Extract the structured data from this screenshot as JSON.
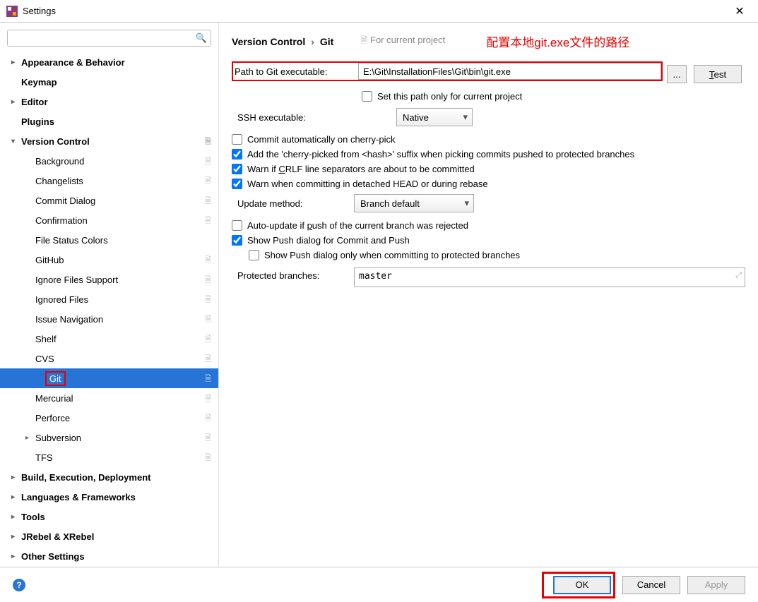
{
  "window": {
    "title": "Settings"
  },
  "search": {
    "placeholder": ""
  },
  "sidebar": {
    "items": [
      {
        "label": "Appearance & Behavior",
        "level": 1,
        "expandable": true,
        "expanded": false
      },
      {
        "label": "Keymap",
        "level": 1,
        "expandable": false
      },
      {
        "label": "Editor",
        "level": 1,
        "expandable": true,
        "expanded": false
      },
      {
        "label": "Plugins",
        "level": 1,
        "expandable": false
      },
      {
        "label": "Version Control",
        "level": 1,
        "expandable": true,
        "expanded": true,
        "copy": true
      },
      {
        "label": "Background",
        "level": 2,
        "copy": true
      },
      {
        "label": "Changelists",
        "level": 2,
        "copy": true
      },
      {
        "label": "Commit Dialog",
        "level": 2,
        "copy": true
      },
      {
        "label": "Confirmation",
        "level": 2,
        "copy": true
      },
      {
        "label": "File Status Colors",
        "level": 2
      },
      {
        "label": "GitHub",
        "level": 2,
        "copy": true
      },
      {
        "label": "Ignore Files Support",
        "level": 2,
        "copy": true
      },
      {
        "label": "Ignored Files",
        "level": 2,
        "copy": true
      },
      {
        "label": "Issue Navigation",
        "level": 2,
        "copy": true
      },
      {
        "label": "Shelf",
        "level": 2,
        "copy": true
      },
      {
        "label": "CVS",
        "level": 2,
        "copy": true
      },
      {
        "label": "Git",
        "level": 2,
        "selected": true,
        "copy": true,
        "redbox": true
      },
      {
        "label": "Mercurial",
        "level": 2,
        "copy": true
      },
      {
        "label": "Perforce",
        "level": 2,
        "copy": true
      },
      {
        "label": "Subversion",
        "level": 2,
        "expandable": true,
        "expanded": false,
        "copy": true
      },
      {
        "label": "TFS",
        "level": 2,
        "copy": true
      },
      {
        "label": "Build, Execution, Deployment",
        "level": 1,
        "expandable": true,
        "expanded": false
      },
      {
        "label": "Languages & Frameworks",
        "level": 1,
        "expandable": true,
        "expanded": false
      },
      {
        "label": "Tools",
        "level": 1,
        "expandable": true,
        "expanded": false
      },
      {
        "label": "JRebel & XRebel",
        "level": 1,
        "expandable": true,
        "expanded": false
      },
      {
        "label": "Other Settings",
        "level": 1,
        "expandable": true,
        "expanded": false
      }
    ]
  },
  "breadcrumb": {
    "a": "Version Control",
    "b": "Git",
    "scope": "For current project"
  },
  "annotation": "配置本地git.exe文件的路径",
  "git": {
    "path_label": "Path to Git executable:",
    "path_value": "E:\\Git\\InstallationFiles\\Git\\bin\\git.exe",
    "browse": "...",
    "test_prefix": "T",
    "test_suffix": "est",
    "set_path_project": "Set this path only for current project",
    "ssh_label": "SSH executable:",
    "ssh_value": "Native",
    "cb_cherry": "Commit automatically on cherry-pick",
    "cb_suffix": "Add the 'cherry-picked from <hash>' suffix when picking commits pushed to protected branches",
    "cb_crlf_prefix": "Warn if ",
    "cb_crlf_u": "C",
    "cb_crlf_suffix": "RLF line separators are about to be committed",
    "cb_detached": "Warn when committing in detached HEAD or during rebase",
    "update_label": "Update method:",
    "update_value": "Branch default",
    "cb_autoupdate_prefix": "Auto-update if ",
    "cb_autoupdate_u": "p",
    "cb_autoupdate_suffix": "ush of the current branch was rejected",
    "cb_showpush": "Show Push dialog for Commit and Push",
    "cb_showpush_protected": "Show Push dialog only when committing to protected branches",
    "protected_label": "Protected branches:",
    "protected_value": "master"
  },
  "footer": {
    "ok": "OK",
    "cancel": "Cancel",
    "apply": "Apply"
  }
}
